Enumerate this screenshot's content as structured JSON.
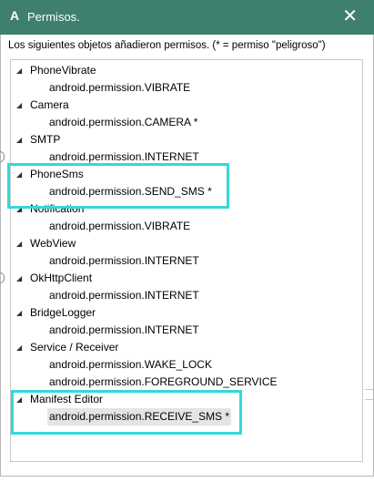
{
  "dialog": {
    "icon_letter": "A",
    "title": "Permisos.",
    "close_glyph": "✕",
    "description": "Los siguientes objetos añadieron permisos. (* = permiso \"peligroso\")"
  },
  "tree": [
    {
      "label": "PhoneVibrate",
      "expander": "◢",
      "children": [
        "android.permission.VIBRATE"
      ]
    },
    {
      "label": "Camera",
      "expander": "◢",
      "children": [
        "android.permission.CAMERA *"
      ]
    },
    {
      "label": "SMTP",
      "expander": "◢",
      "children": [
        "android.permission.INTERNET"
      ]
    },
    {
      "label": "PhoneSms",
      "expander": "◢",
      "children": [
        "android.permission.SEND_SMS *"
      ]
    },
    {
      "label": "Notification",
      "expander": "◢",
      "children": [
        "android.permission.VIBRATE"
      ]
    },
    {
      "label": "WebView",
      "expander": "◢",
      "children": [
        "android.permission.INTERNET"
      ]
    },
    {
      "label": "OkHttpClient",
      "expander": "◢",
      "children": [
        "android.permission.INTERNET"
      ]
    },
    {
      "label": "BridgeLogger",
      "expander": "◢",
      "children": [
        "android.permission.INTERNET"
      ]
    },
    {
      "label": "Service / Receiver",
      "expander": "◢",
      "children": [
        "android.permission.WAKE_LOCK",
        "android.permission.FOREGROUND_SERVICE"
      ]
    },
    {
      "label": "Manifest Editor",
      "expander": "◢",
      "children": [
        "android.permission.RECEIVE_SMS *"
      ]
    }
  ],
  "colors": {
    "titlebar": "#3e7f70",
    "highlight": "#33d9d9",
    "selection": "#e5e5e5"
  }
}
